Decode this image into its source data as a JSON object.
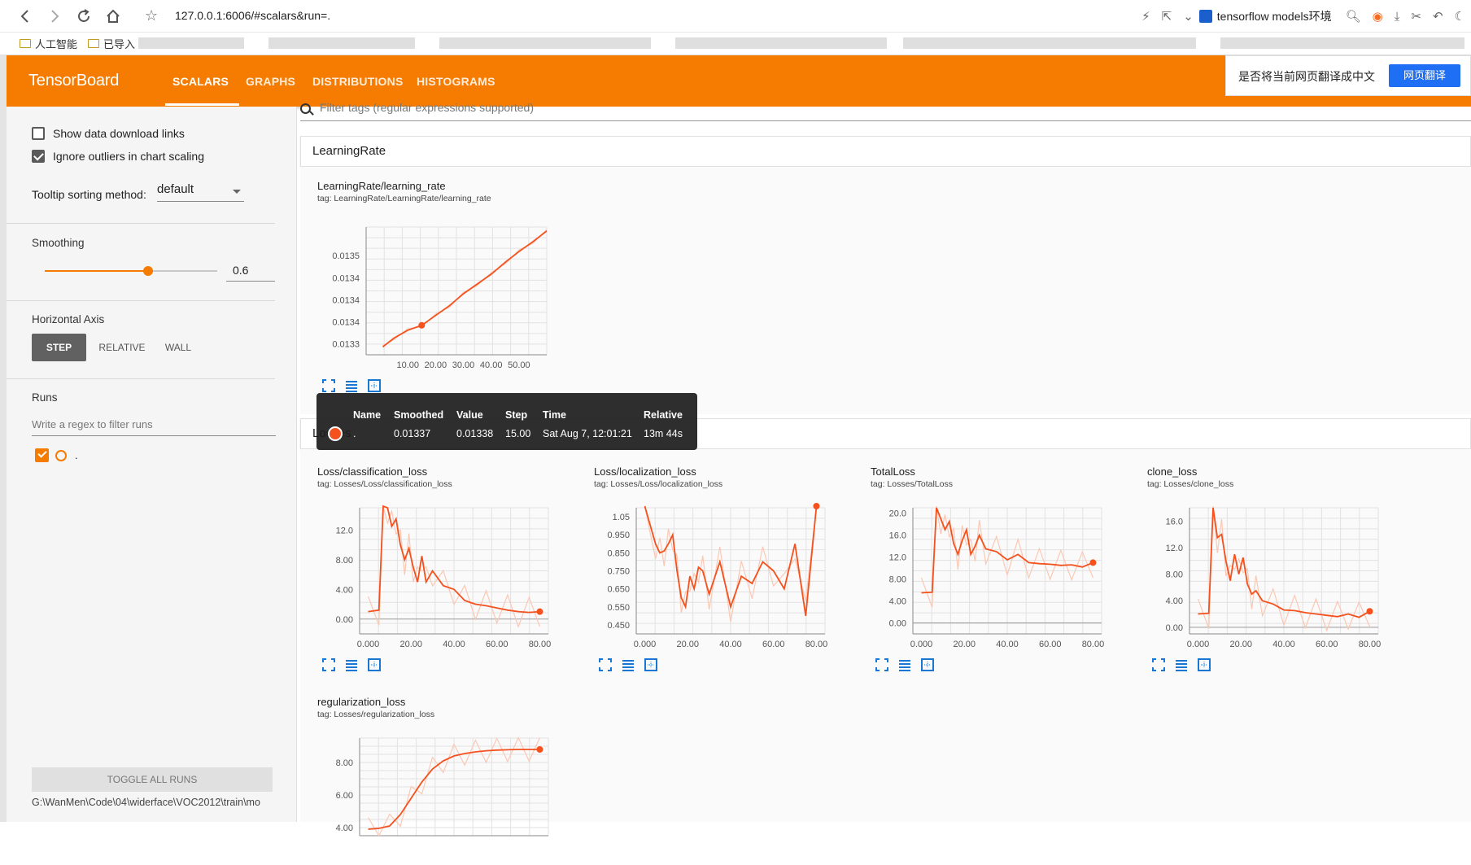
{
  "browser": {
    "url": "127.0.0.1:6006/#scalars&run=.",
    "search_text": "tensorflow models环境",
    "bookmarks": [
      "人工智能",
      "已导入"
    ]
  },
  "toolbar": {
    "title": "TensorBoard",
    "tabs": [
      "SCALARS",
      "GRAPHS",
      "DISTRIBUTIONS",
      "HISTOGRAMS"
    ],
    "active_tab": "SCALARS"
  },
  "translate": {
    "prompt": "是否将当前网页翻译成中文",
    "button": "网页翻译"
  },
  "sidebar": {
    "show_download_links": "Show data download links",
    "ignore_outliers": "Ignore outliers in chart scaling",
    "tooltip_sort_label": "Tooltip sorting method:",
    "tooltip_sort_value": "default",
    "smoothing_label": "Smoothing",
    "smoothing_value": "0.6",
    "horizontal_axis_label": "Horizontal Axis",
    "axis_options": [
      "STEP",
      "RELATIVE",
      "WALL"
    ],
    "runs_label": "Runs",
    "runs_placeholder": "Write a regex to filter runs",
    "run_name": ".",
    "toggle_all": "TOGGLE ALL RUNS",
    "logdir": "G:\\WanMen\\Code\\04\\widerface\\VOC2012\\train\\mo"
  },
  "main": {
    "filter_placeholder": "Filter tags (regular expressions supported)",
    "categories": [
      "LearningRate",
      "Losses"
    ]
  },
  "tooltip": {
    "headers": [
      "Name",
      "Smoothed",
      "Value",
      "Step",
      "Time",
      "Relative"
    ],
    "values": [
      ".",
      "0.01337",
      "0.01338",
      "15.00",
      "Sat Aug 7, 12:01:21",
      "13m 44s"
    ]
  },
  "chart_data": [
    {
      "type": "line",
      "title": "LearningRate/learning_rate",
      "tag": "tag: LearningRate/LearningRate/learning_rate",
      "x": [
        1,
        5,
        10,
        15,
        20,
        25,
        30,
        35,
        40,
        45,
        50,
        55,
        60
      ],
      "series": [
        {
          "values": [
            0.013318,
            0.013327,
            0.013335,
            0.01334,
            0.01335,
            0.01336,
            0.013372,
            0.013382,
            0.013392,
            0.013404,
            0.013415,
            0.013425,
            0.013436
          ]
        }
      ],
      "xticks": [
        "10.00",
        "20.00",
        "30.00",
        "40.00",
        "50.00"
      ],
      "yticks": [
        "0.0133",
        "0.0134",
        "0.0134",
        "0.0134",
        "0.0135"
      ],
      "xlim": [
        -5,
        60
      ],
      "ylim": [
        0.01331,
        0.01344
      ]
    },
    {
      "type": "line",
      "title": "Loss/classification_loss",
      "tag": "tag: Losses/Loss/classification_loss",
      "x": [
        0,
        5,
        7,
        9,
        11,
        13,
        15,
        17,
        19,
        21,
        23,
        25,
        27,
        30,
        35,
        40,
        45,
        50,
        55,
        60,
        65,
        70,
        75,
        80
      ],
      "series": [
        {
          "values": [
            1.0,
            1.2,
            16.0,
            15.0,
            12.5,
            13.5,
            10.0,
            8.0,
            9.5,
            7.0,
            5.0,
            8.5,
            5.0,
            6.5,
            4.5,
            4.0,
            2.5,
            2.0,
            1.8,
            1.5,
            1.2,
            1.0,
            0.9,
            1.0
          ]
        }
      ],
      "xticks": [
        "0.000",
        "20.00",
        "40.00",
        "60.00",
        "80.00"
      ],
      "yticks": [
        "0.00",
        "4.00",
        "8.00",
        "12.0"
      ],
      "xlim": [
        -4,
        84
      ],
      "ylim": [
        -2,
        15
      ]
    },
    {
      "type": "line",
      "title": "Loss/localization_loss",
      "tag": "tag: Losses/Loss/localization_loss",
      "x": [
        0,
        5,
        7,
        9,
        11,
        13,
        15,
        17,
        19,
        21,
        23,
        25,
        27,
        30,
        35,
        40,
        45,
        50,
        55,
        60,
        65,
        70,
        75,
        80
      ],
      "series": [
        {
          "values": [
            1.3,
            0.9,
            0.85,
            0.86,
            0.9,
            0.95,
            0.75,
            0.6,
            0.55,
            0.72,
            0.65,
            0.77,
            0.75,
            0.62,
            0.8,
            0.55,
            0.72,
            0.68,
            0.8,
            0.75,
            0.65,
            0.9,
            0.5,
            1.35
          ]
        }
      ],
      "xticks": [
        "0.000",
        "20.00",
        "40.00",
        "60.00",
        "80.00"
      ],
      "yticks": [
        "0.450",
        "0.550",
        "0.650",
        "0.750",
        "0.850",
        "0.950",
        "1.05"
      ],
      "xlim": [
        -4,
        84
      ],
      "ylim": [
        0.4,
        1.1
      ]
    },
    {
      "type": "line",
      "title": "TotalLoss",
      "tag": "tag: Losses/TotalLoss",
      "x": [
        0,
        5,
        7,
        9,
        11,
        13,
        15,
        17,
        19,
        21,
        23,
        25,
        27,
        30,
        35,
        40,
        45,
        50,
        55,
        60,
        65,
        70,
        75,
        80
      ],
      "series": [
        {
          "values": [
            5.5,
            5.6,
            21.0,
            19.0,
            17.0,
            18.5,
            14.5,
            12.5,
            15.0,
            17.0,
            12.5,
            14.0,
            16.0,
            13.5,
            13.0,
            11.5,
            12.5,
            11.0,
            10.8,
            10.7,
            10.5,
            10.6,
            10.2,
            11.0
          ]
        }
      ],
      "xticks": [
        "0.000",
        "20.00",
        "40.00",
        "60.00",
        "80.00"
      ],
      "yticks": [
        "0.00",
        "4.00",
        "8.00",
        "12.0",
        "16.0",
        "20.0"
      ],
      "xlim": [
        -4,
        84
      ],
      "ylim": [
        -2,
        21
      ]
    },
    {
      "type": "line",
      "title": "clone_loss",
      "tag": "tag: Losses/clone_loss",
      "x": [
        0,
        5,
        7,
        9,
        11,
        13,
        15,
        17,
        19,
        21,
        23,
        25,
        27,
        30,
        35,
        40,
        45,
        50,
        55,
        60,
        65,
        70,
        75,
        80
      ],
      "series": [
        {
          "values": [
            2.0,
            2.1,
            18.0,
            13.5,
            14.0,
            10.0,
            7.0,
            11.0,
            8.0,
            10.5,
            6.5,
            5.0,
            5.5,
            4.0,
            3.5,
            2.6,
            2.5,
            2.2,
            2.0,
            1.8,
            1.6,
            2.0,
            1.5,
            2.4
          ]
        }
      ],
      "xticks": [
        "0.000",
        "20.00",
        "40.00",
        "60.00",
        "80.00"
      ],
      "yticks": [
        "0.00",
        "4.00",
        "8.00",
        "12.0",
        "16.0"
      ],
      "xlim": [
        -4,
        84
      ],
      "ylim": [
        -1,
        18
      ]
    },
    {
      "type": "line",
      "title": "regularization_loss",
      "tag": "tag: Losses/regularization_loss",
      "x": [
        0,
        5,
        10,
        15,
        20,
        25,
        30,
        35,
        40,
        45,
        50,
        55,
        60,
        65,
        70,
        75,
        80
      ],
      "series": [
        {
          "values": [
            3.9,
            3.95,
            4.1,
            4.8,
            5.8,
            6.8,
            7.6,
            8.1,
            8.4,
            8.55,
            8.65,
            8.72,
            8.76,
            8.78,
            8.8,
            8.8,
            8.8
          ]
        }
      ],
      "xticks": [],
      "yticks": [
        "4.00",
        "6.00",
        "8.00"
      ],
      "xlim": [
        -4,
        84
      ],
      "ylim": [
        3.5,
        9.5
      ]
    }
  ]
}
